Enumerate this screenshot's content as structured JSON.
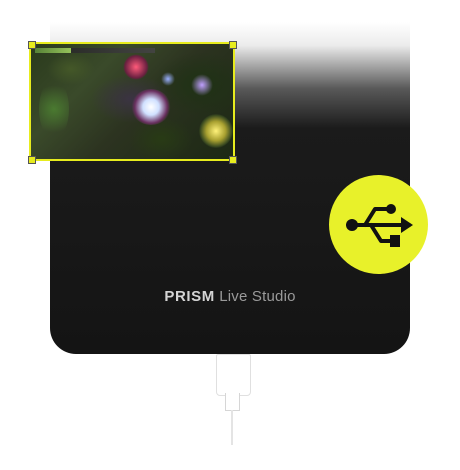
{
  "brand": {
    "name_strong": "PRISM",
    "name_light": "Live Studio"
  },
  "icons": {
    "connection": "usb-icon",
    "cable": "usb-cable-icon"
  },
  "colors": {
    "accent": "#e8f12a",
    "device": "#1e1e1e",
    "brand_text": "#b8b8b8"
  }
}
